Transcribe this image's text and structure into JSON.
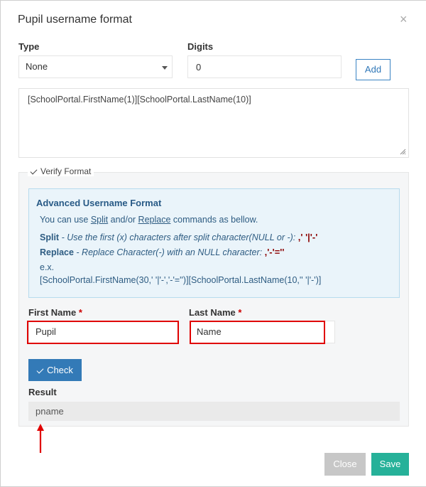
{
  "dialog": {
    "title": "Pupil username format",
    "close_glyph": "×"
  },
  "type_field": {
    "label": "Type",
    "value": "None"
  },
  "digits_field": {
    "label": "Digits",
    "value": "0"
  },
  "add_button": "Add",
  "format_text": "[SchoolPortal.FirstName(1)][SchoolPortal.LastName(10)]",
  "verify": {
    "legend": "Verify Format",
    "info": {
      "title": "Advanced Username Format",
      "line1_a": "You can use ",
      "line1_split": "Split",
      "line1_b": " and/or ",
      "line1_replace": "Replace",
      "line1_c": " commands as bellow.",
      "split_label": "Split",
      "split_desc": " - Use the first (x) characters after split character(NULL or -): ",
      "split_code": ",' '|'-'",
      "replace_label": "Replace",
      "replace_desc": " - Replace Character(-) with an NULL character: ",
      "replace_code": ",'-'=''",
      "example_label": "e.x.",
      "example_code": "[SchoolPortal.FirstName(30,' '|'-','-'='')][SchoolPortal.LastName(10,'' '|'-')]"
    },
    "first_name": {
      "label": "First Name",
      "required_mark": "*",
      "value": "Pupil"
    },
    "last_name": {
      "label": "Last Name",
      "required_mark": "*",
      "value": "Name"
    },
    "check_button": "Check",
    "result_label": "Result",
    "result_value": "pname"
  },
  "footer": {
    "close_button": "Close",
    "save_button": "Save"
  },
  "colors": {
    "primary": "#337ab7",
    "save": "#26b199",
    "close": "#c7c7c7",
    "highlight": "#e00000"
  }
}
